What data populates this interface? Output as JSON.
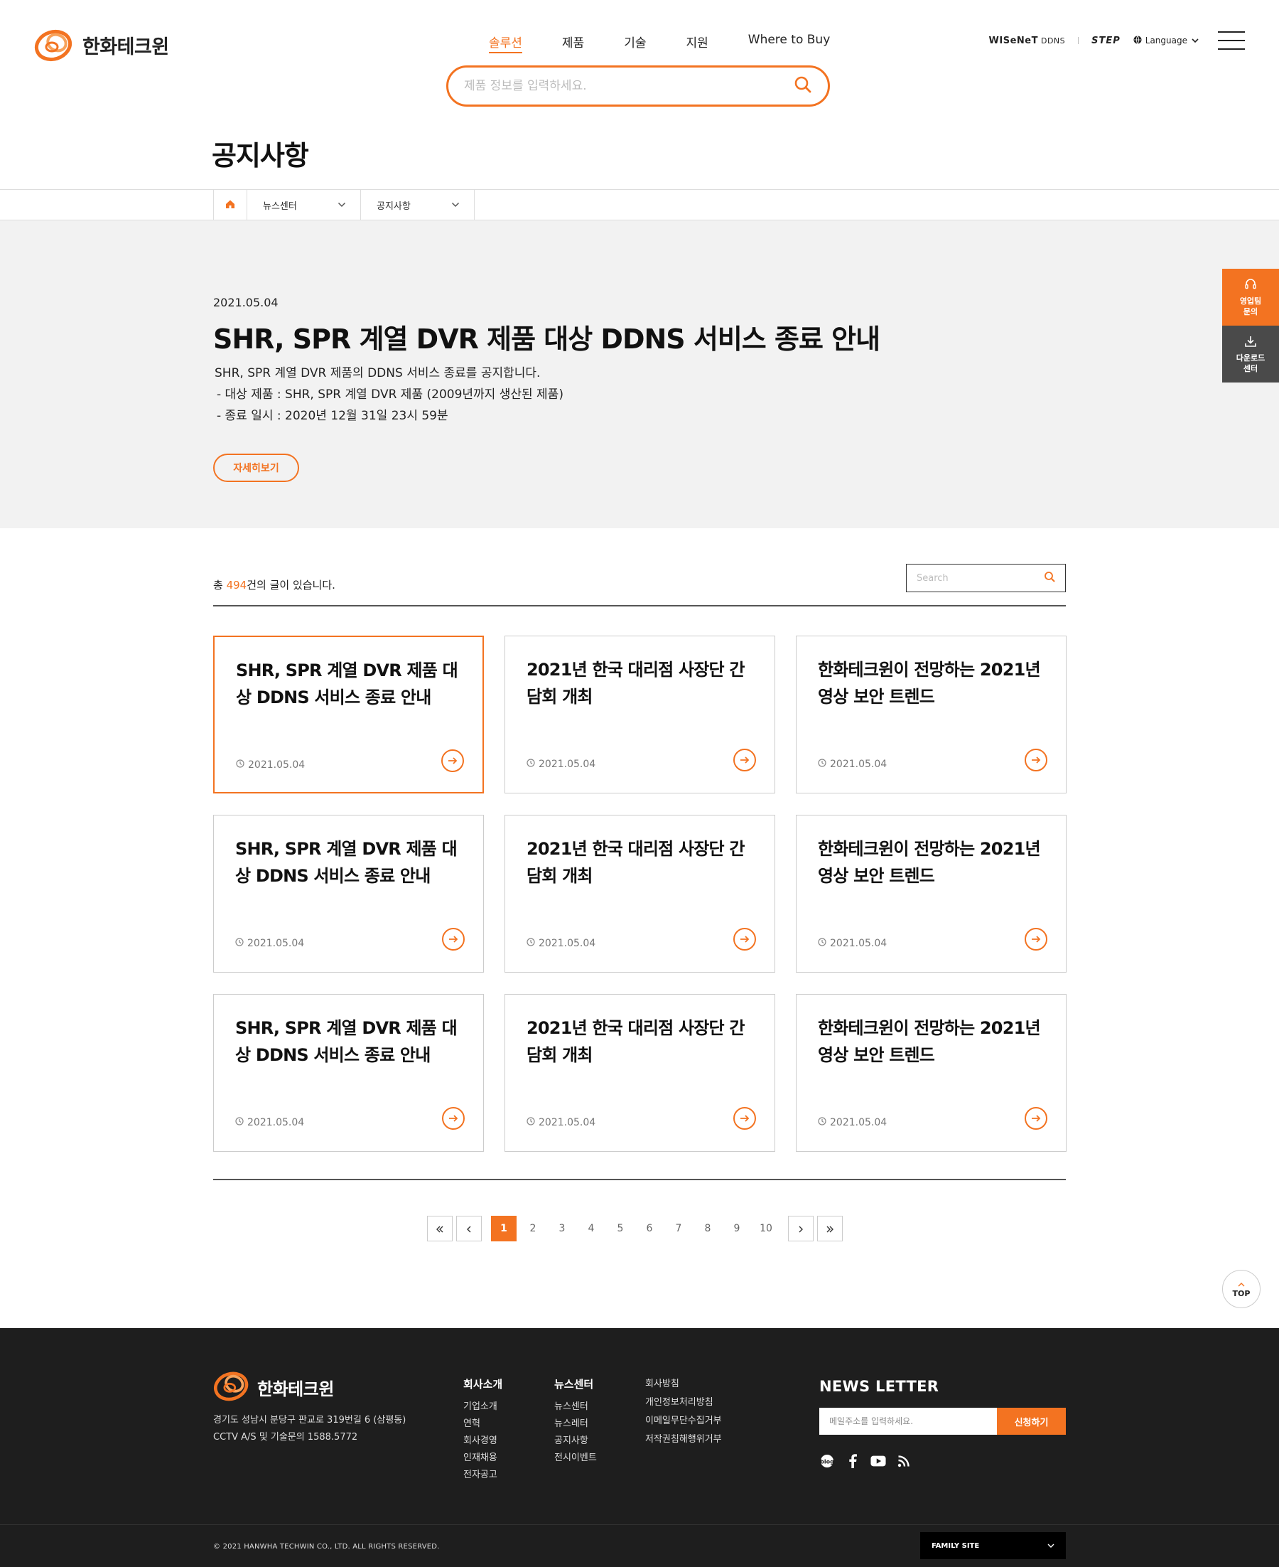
{
  "header": {
    "logo_text": "한화테크윈",
    "nav": [
      {
        "label": "솔루션",
        "active": true
      },
      {
        "label": "제품",
        "active": false
      },
      {
        "label": "기술",
        "active": false
      },
      {
        "label": "지원",
        "active": false
      },
      {
        "label": "Where to Buy",
        "active": false
      }
    ],
    "util": {
      "wisenet": "WISeNeT",
      "ddns": "DDNS",
      "step": "STEP",
      "language": "Language"
    },
    "search_placeholder": "제품 정보를 입력하세요."
  },
  "page_title": "공지사항",
  "breadcrumb": {
    "level1": "뉴스센터",
    "level2": "공지사항"
  },
  "featured": {
    "date": "2021.05.04",
    "title": "SHR, SPR 계열 DVR 제품 대상 DDNS 서비스 종료 안내",
    "desc": [
      "SHR, SPR 계열 DVR 제품의 DDNS 서비스 종료를 공지합니다.",
      "- 대상 제품 : SHR, SPR 계열 DVR 제품 (2009년까지 생산된 제품)",
      "- 종료 일시 : 2020년 12월 31일 23시 59분"
    ],
    "button": "자세히보기"
  },
  "quick_menu": [
    {
      "label_line1": "영업팀",
      "label_line2": "문의",
      "icon": "headset-icon"
    },
    {
      "label_line1": "다운로드",
      "label_line2": "센터",
      "icon": "download-icon"
    }
  ],
  "list": {
    "count_prefix": "총 ",
    "count": "494",
    "count_suffix": "건의 글이 있습니다.",
    "search_placeholder": "Search",
    "cards": [
      {
        "title": "SHR, SPR 계열 DVR 제품 대상 DDNS 서비스 종료 안내",
        "date": "2021.05.04",
        "active": true
      },
      {
        "title": "2021년 한국 대리점 사장단 간담회 개최",
        "date": "2021.05.04",
        "active": false
      },
      {
        "title": "한화테크윈이 전망하는 2021년 영상 보안 트렌드",
        "date": "2021.05.04",
        "active": false
      },
      {
        "title": "SHR, SPR 계열 DVR 제품 대상 DDNS 서비스 종료 안내",
        "date": "2021.05.04",
        "active": false
      },
      {
        "title": "2021년 한국 대리점 사장단 간담회 개최",
        "date": "2021.05.04",
        "active": false
      },
      {
        "title": "한화테크윈이 전망하는 2021년 영상 보안 트렌드",
        "date": "2021.05.04",
        "active": false
      },
      {
        "title": "SHR, SPR 계열 DVR 제품 대상 DDNS 서비스 종료 안내",
        "date": "2021.05.04",
        "active": false
      },
      {
        "title": "2021년 한국 대리점 사장단 간담회 개최",
        "date": "2021.05.04",
        "active": false
      },
      {
        "title": "한화테크윈이 전망하는 2021년 영상 보안 트렌드",
        "date": "2021.05.04",
        "active": false
      }
    ]
  },
  "pagination": {
    "pages": [
      "1",
      "2",
      "3",
      "4",
      "5",
      "6",
      "7",
      "8",
      "9",
      "10"
    ],
    "current": "1"
  },
  "top_button": "TOP",
  "footer": {
    "logo_text": "한화테크윈",
    "address": "경기도 성남시 분당구 판교로 319번길 6 (삼평동)",
    "contact": "CCTV A/S 및 기술문의 1588.5772",
    "col1": {
      "title": "회사소개",
      "links": [
        "기업소개",
        "연혁",
        "회사경영",
        "인재채용",
        "전자공고"
      ]
    },
    "col2": {
      "title": "뉴스센터",
      "links": [
        "뉴스센터",
        "뉴스레터",
        "공지사항",
        "전시이벤트"
      ]
    },
    "col3": {
      "links": [
        "회사방침",
        "개인정보처리방침",
        "이메일무단수집거부",
        "저작권침해행위거부"
      ]
    },
    "newsletter": {
      "title": "NEWS LETTER",
      "placeholder": "메일주소를 입력하세요.",
      "button": "신청하기"
    },
    "copyright": "© 2021 HANWHA TECHWIN CO., LTD. ALL RIGHTS RESERVED.",
    "family_site": "FAMILY SITE"
  },
  "colors": {
    "accent": "#f37321",
    "footer_bg": "#1e1e1e",
    "featured_bg": "#f2f2f2"
  }
}
